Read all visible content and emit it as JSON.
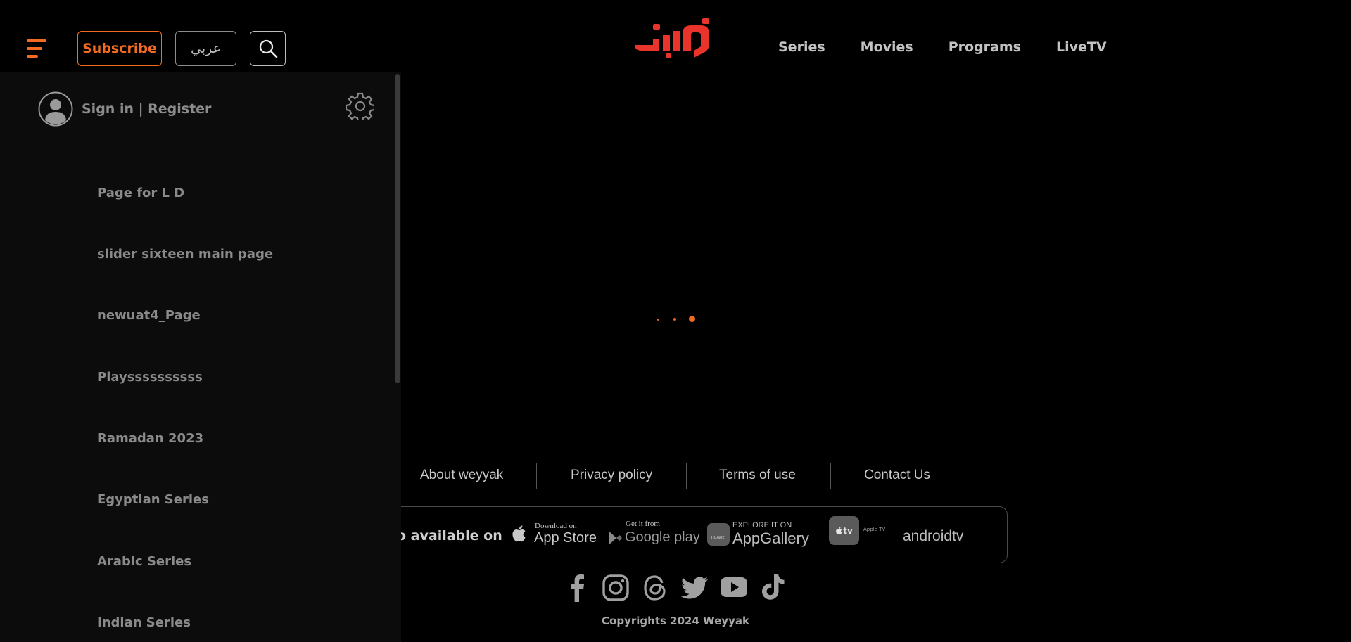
{
  "header": {
    "subscribe_label": "Subscribe",
    "language_label": "عربي",
    "nav": [
      "Series",
      "Movies",
      "Programs",
      "LiveTV"
    ]
  },
  "sidebar": {
    "signin_label": "Sign in | Register",
    "items": [
      "Page for L D",
      "slider sixteen main page",
      "newuat4_Page",
      "Playssssssssss",
      "Ramadan 2023",
      "Egyptian Series",
      "Arabic Series",
      "Indian Series"
    ]
  },
  "footer": {
    "links": [
      "About weyyak",
      "Privacy policy",
      "Terms of use",
      "Contact Us"
    ],
    "available_label": "o available on",
    "stores": {
      "appstore_small": "Download on",
      "appstore_big": "App Store",
      "googleplay_small": "Get it from",
      "googleplay_big": "Google play",
      "appgallery_small": "EXPLORE IT ON",
      "appgallery_big": "AppGallery",
      "huawei": "HUAWEI",
      "appletv_badge": "tv",
      "appletv_label": "Apple TV",
      "androidtv": "androidtv"
    },
    "copyright": "Copyrights 2024 Weyyak"
  },
  "colors": {
    "accent": "#f26b21",
    "logo": "#e8342a",
    "panel": "#0c0c0c"
  },
  "icons": [
    "hamburger-menu-icon",
    "search-icon",
    "user-avatar-icon",
    "gear-icon",
    "apple-icon",
    "google-play-icon",
    "huawei-icon",
    "facebook-icon",
    "instagram-icon",
    "threads-icon",
    "twitter-icon",
    "youtube-icon",
    "tiktok-icon"
  ]
}
